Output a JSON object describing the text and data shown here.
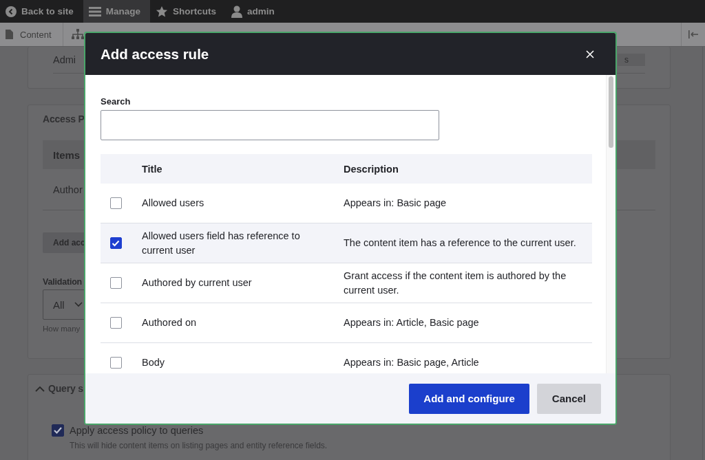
{
  "toolbar": {
    "items": [
      {
        "label": "Back to site",
        "kind": "back",
        "selected": false
      },
      {
        "label": "Manage",
        "kind": "menu",
        "selected": true
      },
      {
        "label": "Shortcuts",
        "kind": "star",
        "selected": false
      },
      {
        "label": "admin",
        "kind": "user",
        "selected": false
      }
    ]
  },
  "secondary_toolbar": {
    "items": [
      {
        "label": "Content",
        "kind": "page"
      }
    ]
  },
  "page": {
    "top_card": {
      "text": "Admi",
      "button": "s"
    },
    "access_card": {
      "heading": "Access P",
      "table_header": "Items",
      "row": "Author",
      "button": "Add acc",
      "validation_label": "Validation",
      "select_value": "All",
      "help": "How many"
    },
    "query_card": {
      "heading": "Query s",
      "expanded": true,
      "checkbox": {
        "label": "Apply access policy to queries",
        "checked": true,
        "description": "This will hide content items on listing pages and entity reference fields."
      }
    }
  },
  "dialog": {
    "title": "Add access rule",
    "search": {
      "label": "Search"
    },
    "columns": [
      "Title",
      "Description"
    ],
    "rows": [
      {
        "title": "Allowed users",
        "description": "Appears in: Basic page",
        "selected": false
      },
      {
        "title": "Allowed users field has reference to current user",
        "description": "The content item has a reference to the current user.",
        "selected": true
      },
      {
        "title": "Authored by current user",
        "description": "Grant access if the content item is authored by the current user.",
        "selected": false
      },
      {
        "title": "Authored on",
        "description": "Appears in: Article, Basic page",
        "selected": false
      },
      {
        "title": "Body",
        "description": "Appears in: Basic page, Article",
        "selected": false
      }
    ],
    "buttons": [
      {
        "label": "Add and configure",
        "kind": "primary"
      },
      {
        "label": "Cancel",
        "kind": "secondary"
      }
    ]
  }
}
